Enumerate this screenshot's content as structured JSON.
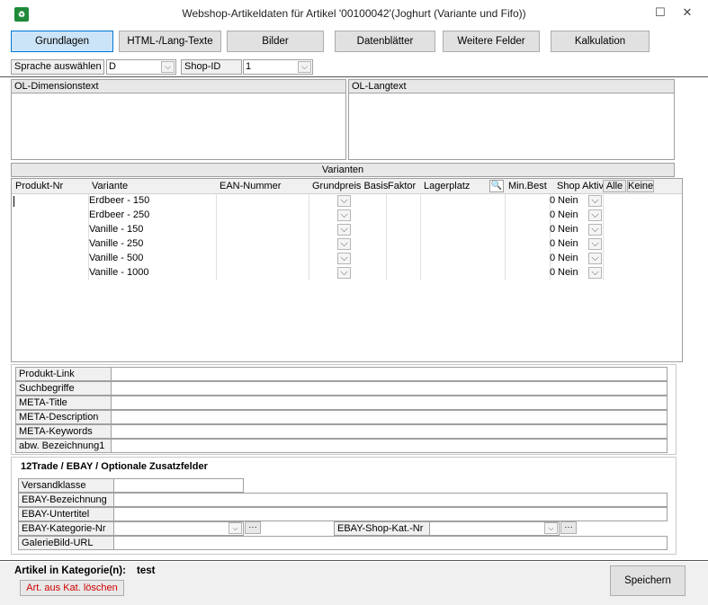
{
  "window": {
    "title": "Webshop-Artikeldaten für Artikel '00100042'(Joghurt (Variante und Fifo))",
    "maximize_glyph": "☐",
    "close_glyph": "✕"
  },
  "tabs": [
    {
      "label": "Grundlagen",
      "active": true
    },
    {
      "label": "HTML-/Lang-Texte"
    },
    {
      "label": "Bilder"
    },
    {
      "label": "Datenblätter"
    },
    {
      "label": "Weitere Felder"
    },
    {
      "label": "Kalkulation"
    }
  ],
  "filters": {
    "language_label": "Sprache auswählen",
    "language_value": "D",
    "shop_label": "Shop-ID",
    "shop_value": "1"
  },
  "texts": {
    "dimension_label": "OL-Dimensionstext",
    "long_label": "OL-Langtext"
  },
  "variants": {
    "title": "Varianten",
    "columns": {
      "product_nr": "Produkt-Nr",
      "variant": "Variante",
      "ean": "EAN-Nummer",
      "base_price": "Grundpreis Basis",
      "factor": "Faktor",
      "storage": "Lagerplatz",
      "min_order": "Min.Best",
      "shop_active": "Shop Aktiv"
    },
    "all_button": "Alle",
    "none_button": "Keine",
    "rows": [
      {
        "variant": "Erdbeer - 150",
        "min": "0",
        "active": "Nein"
      },
      {
        "variant": "Erdbeer - 250",
        "min": "0",
        "active": "Nein"
      },
      {
        "variant": "Vanille - 150",
        "min": "0",
        "active": "Nein"
      },
      {
        "variant": "Vanille - 250",
        "min": "0",
        "active": "Nein"
      },
      {
        "variant": "Vanille - 500",
        "min": "0",
        "active": "Nein"
      },
      {
        "variant": "Vanille - 1000",
        "min": "0",
        "active": "Nein"
      }
    ]
  },
  "seo_fields": [
    "Produkt-Link",
    "Suchbegriffe",
    "META-Title",
    "META-Description",
    "META-Keywords",
    "abw. Bezeichnung1"
  ],
  "ebay": {
    "title": "12Trade / EBAY / Optionale Zusatzfelder",
    "shipping_label": "Versandklasse",
    "name_label": "EBAY-Bezeichnung",
    "subtitle_label": "EBAY-Untertitel",
    "category_label": "EBAY-Kategorie-Nr",
    "shop_category_label": "EBAY-Shop-Kat.-Nr",
    "gallery_label": "GalerieBild-URL",
    "more_glyph": "···"
  },
  "footer": {
    "category_label": "Artikel in Kategorie(n):",
    "category_value": "test",
    "delete_button": "Art. aus Kat. löschen",
    "save_button": "Speichern"
  },
  "colors": {
    "active_tab": "#cce4f7",
    "delete_text": "#d00000"
  }
}
